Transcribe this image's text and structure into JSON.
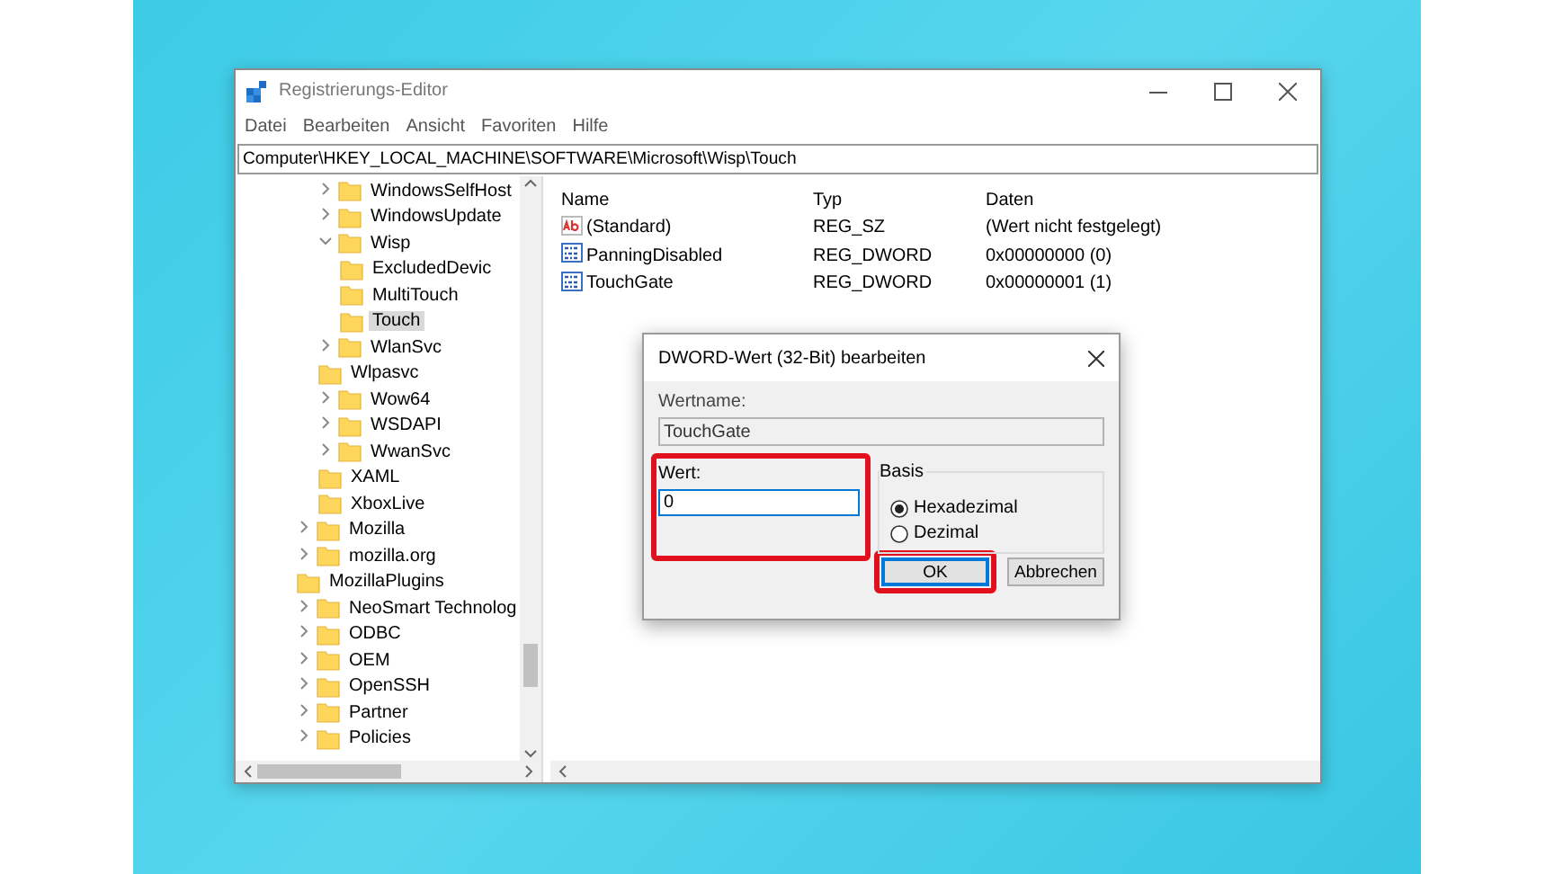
{
  "window": {
    "title": "Registrierungs-Editor"
  },
  "menu": [
    "Datei",
    "Bearbeiten",
    "Ansicht",
    "Favoriten",
    "Hilfe"
  ],
  "address": "Computer\\HKEY_LOCAL_MACHINE\\SOFTWARE\\Microsoft\\Wisp\\Touch",
  "tree": {
    "nested_items": [
      {
        "label": "WindowsSelfHost",
        "expandable": true,
        "expanded": false,
        "selected": false
      },
      {
        "label": "WindowsUpdate",
        "expandable": true,
        "expanded": false,
        "selected": false
      },
      {
        "label": "Wisp",
        "expandable": true,
        "expanded": true,
        "selected": false,
        "children": [
          {
            "label": "ExcludedDevic",
            "expandable": false,
            "selected": false
          },
          {
            "label": "MultiTouch",
            "expandable": false,
            "selected": false
          },
          {
            "label": "Touch",
            "expandable": false,
            "selected": true
          }
        ]
      },
      {
        "label": "WlanSvc",
        "expandable": true,
        "expanded": false,
        "selected": false
      },
      {
        "label": "Wlpasvc",
        "expandable": false,
        "selected": false
      },
      {
        "label": "Wow64",
        "expandable": true,
        "expanded": false,
        "selected": false
      },
      {
        "label": "WSDAPI",
        "expandable": true,
        "expanded": false,
        "selected": false
      },
      {
        "label": "WwanSvc",
        "expandable": true,
        "expanded": false,
        "selected": false
      },
      {
        "label": "XAML",
        "expandable": false,
        "selected": false
      },
      {
        "label": "XboxLive",
        "expandable": false,
        "selected": false
      }
    ],
    "items": [
      {
        "label": "Mozilla",
        "expandable": true,
        "expanded": false,
        "selected": false
      },
      {
        "label": "mozilla.org",
        "expandable": true,
        "expanded": false,
        "selected": false
      },
      {
        "label": "MozillaPlugins",
        "expandable": false,
        "selected": false
      },
      {
        "label": "NeoSmart Technolog",
        "expandable": true,
        "expanded": false,
        "selected": false
      },
      {
        "label": "ODBC",
        "expandable": true,
        "expanded": false,
        "selected": false
      },
      {
        "label": "OEM",
        "expandable": true,
        "expanded": false,
        "selected": false
      },
      {
        "label": "OpenSSH",
        "expandable": true,
        "expanded": false,
        "selected": false
      },
      {
        "label": "Partner",
        "expandable": true,
        "expanded": false,
        "selected": false
      },
      {
        "label": "Policies",
        "expandable": true,
        "expanded": false,
        "selected": false
      }
    ]
  },
  "values": {
    "columns": [
      "Name",
      "Typ",
      "Daten"
    ],
    "rows": [
      {
        "kind": "string",
        "name": "(Standard)",
        "type": "REG_SZ",
        "data": "(Wert nicht festgelegt)"
      },
      {
        "kind": "binary",
        "name": "PanningDisabled",
        "type": "REG_DWORD",
        "data": "0x00000000 (0)"
      },
      {
        "kind": "binary",
        "name": "TouchGate",
        "type": "REG_DWORD",
        "data": "0x00000001 (1)"
      }
    ]
  },
  "dialog": {
    "title": "DWORD-Wert (32-Bit) bearbeiten",
    "name_label": "Wertname:",
    "name_value": "TouchGate",
    "value_label": "Wert:",
    "value": "0",
    "value_highlighted": true,
    "base_label": "Basis",
    "bases": [
      {
        "label": "Hexadezimal",
        "selected": true
      },
      {
        "label": "Dezimal",
        "selected": false
      }
    ],
    "buttons": [
      {
        "label": "OK",
        "default": true,
        "highlighted": true
      },
      {
        "label": "Abbrechen",
        "default": false,
        "highlighted": false
      }
    ]
  }
}
